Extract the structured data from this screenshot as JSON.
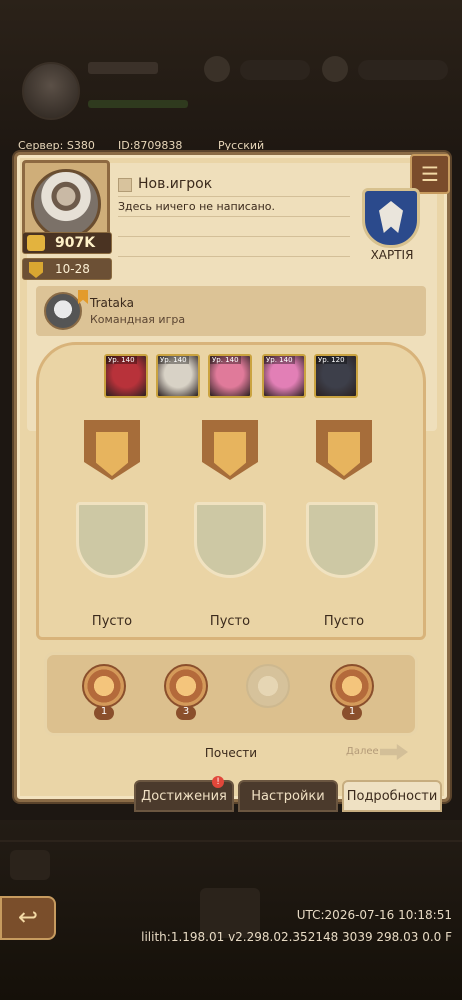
{
  "header": {
    "server": "Сервер: S380",
    "id": "ID:8709838",
    "language": "Русский"
  },
  "profile": {
    "name": "Нов.игрок",
    "motto": "Здесь ничего не написано.",
    "power": "907K",
    "guild_level": "10-28",
    "emblem_label": "ХАРТІЯ"
  },
  "partner": {
    "name": "Trataka",
    "mode": "Командная игра"
  },
  "heroes": [
    {
      "level": "Ур. 140",
      "color": "#b8323a"
    },
    {
      "level": "Ур. 140",
      "color": "#d8d2c6"
    },
    {
      "level": "Ур. 140",
      "color": "#e07a9a"
    },
    {
      "level": "Ур. 140",
      "color": "#e27fb6"
    },
    {
      "level": "Ур. 120",
      "color": "#3d3f4a"
    }
  ],
  "medal_slots": [
    {
      "label": "Пусто"
    },
    {
      "label": "Пусто"
    },
    {
      "label": "Пусто"
    }
  ],
  "honors": {
    "title": "Почести",
    "more": "Далее",
    "badges": [
      {
        "count": "1",
        "icon": "compass-badge-icon"
      },
      {
        "count": "3",
        "icon": "crown-badge-icon"
      },
      {
        "count": "",
        "icon": "locked-badge-icon"
      },
      {
        "count": "1",
        "icon": "book-badge-icon"
      }
    ]
  },
  "tabs": {
    "achievements": "Достижения",
    "achievements_badge": "!",
    "settings": "Настройки",
    "details": "Подробности"
  },
  "footer": {
    "utc": "UTC:2026-07-16 10:18:51",
    "version": "lilith:1.198.01 v2.298.02.352148 3039 298.03 0.0 F"
  }
}
